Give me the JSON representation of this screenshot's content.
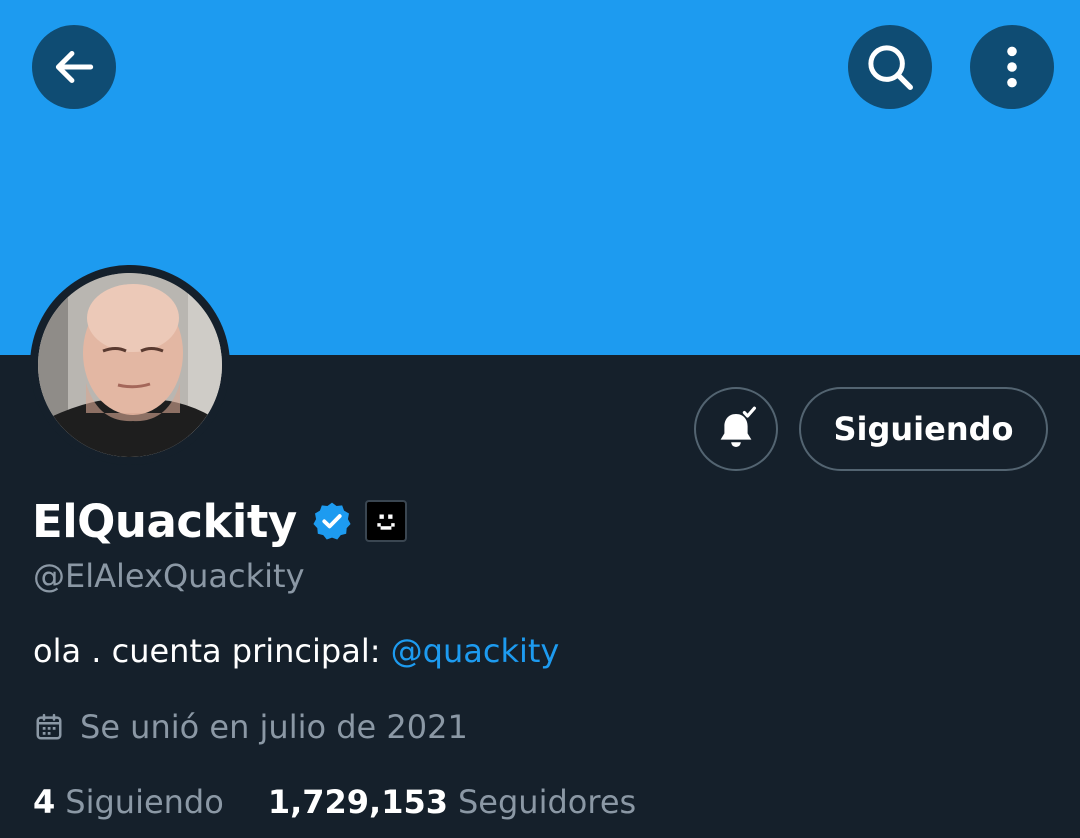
{
  "colors": {
    "banner": "#1d9bf0",
    "background": "#15202b",
    "secondary_text": "#8b98a5",
    "link": "#1d9bf0",
    "button_border": "#536471"
  },
  "header": {
    "back_icon": "arrow-left-icon",
    "search_icon": "search-icon",
    "more_icon": "more-vertical-icon"
  },
  "profile": {
    "display_name": "ElQuackity",
    "verified_icon": "verified-badge-icon",
    "emoji_badge_icon": "smiley-face-icon",
    "handle": "@ElAlexQuackity",
    "bio_text": "ola . cuenta principal: ",
    "bio_mention": "@quackity",
    "joined_icon": "calendar-icon",
    "joined_text": "Se unió en julio de 2021"
  },
  "actions": {
    "notifications_icon": "bell-check-icon",
    "follow_label": "Siguiendo"
  },
  "stats": {
    "following_count": "4",
    "following_label": "Siguiendo",
    "followers_count": "1,729,153",
    "followers_label": "Seguidores"
  }
}
